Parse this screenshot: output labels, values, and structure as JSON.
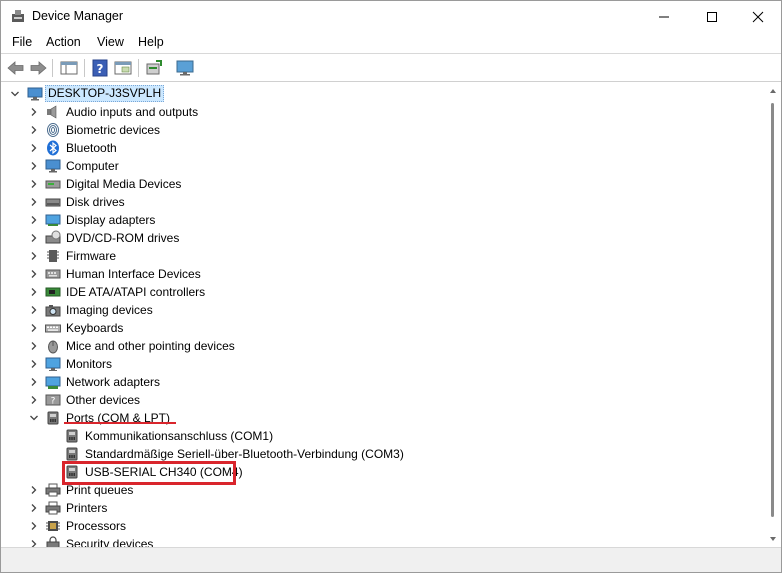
{
  "window": {
    "title": "Device Manager"
  },
  "menu": [
    "File",
    "Action",
    "View",
    "Help"
  ],
  "toolbar": {
    "buttons": [
      "back-arrow-icon",
      "forward-arrow-icon",
      "show-hide-tree-icon",
      "help-icon",
      "properties-pane-icon",
      "update-driver-icon",
      "monitor-icon"
    ]
  },
  "tree": {
    "root": "DESKTOP-J3SVPLH",
    "categories": [
      {
        "label": "Audio inputs and outputs",
        "icon": "speaker-icon"
      },
      {
        "label": "Biometric devices",
        "icon": "fingerprint-icon"
      },
      {
        "label": "Bluetooth",
        "icon": "bluetooth-icon"
      },
      {
        "label": "Computer",
        "icon": "computer-icon"
      },
      {
        "label": "Digital Media Devices",
        "icon": "media-device-icon"
      },
      {
        "label": "Disk drives",
        "icon": "disk-drive-icon"
      },
      {
        "label": "Display adapters",
        "icon": "display-adapter-icon"
      },
      {
        "label": "DVD/CD-ROM drives",
        "icon": "dvd-drive-icon"
      },
      {
        "label": "Firmware",
        "icon": "firmware-icon"
      },
      {
        "label": "Human Interface Devices",
        "icon": "hid-icon"
      },
      {
        "label": "IDE ATA/ATAPI controllers",
        "icon": "ide-controller-icon"
      },
      {
        "label": "Imaging devices",
        "icon": "camera-icon"
      },
      {
        "label": "Keyboards",
        "icon": "keyboard-icon"
      },
      {
        "label": "Mice and other pointing devices",
        "icon": "mouse-icon"
      },
      {
        "label": "Monitors",
        "icon": "monitor-icon"
      },
      {
        "label": "Network adapters",
        "icon": "network-adapter-icon"
      },
      {
        "label": "Other devices",
        "icon": "other-device-icon"
      },
      {
        "label": "Ports (COM & LPT)",
        "icon": "port-icon",
        "expanded": true,
        "children": [
          "Kommunikationsanschluss (COM1)",
          "Standardmäßige Seriell-über-Bluetooth-Verbindung (COM3)",
          "USB-SERIAL CH340 (COM4)"
        ]
      },
      {
        "label": "Print queues",
        "icon": "printer-icon"
      },
      {
        "label": "Printers",
        "icon": "printer-icon"
      },
      {
        "label": "Processors",
        "icon": "processor-icon"
      },
      {
        "label": "Security devices",
        "icon": "security-icon"
      }
    ]
  },
  "annotations": {
    "highlight_color": "#d9252c"
  }
}
